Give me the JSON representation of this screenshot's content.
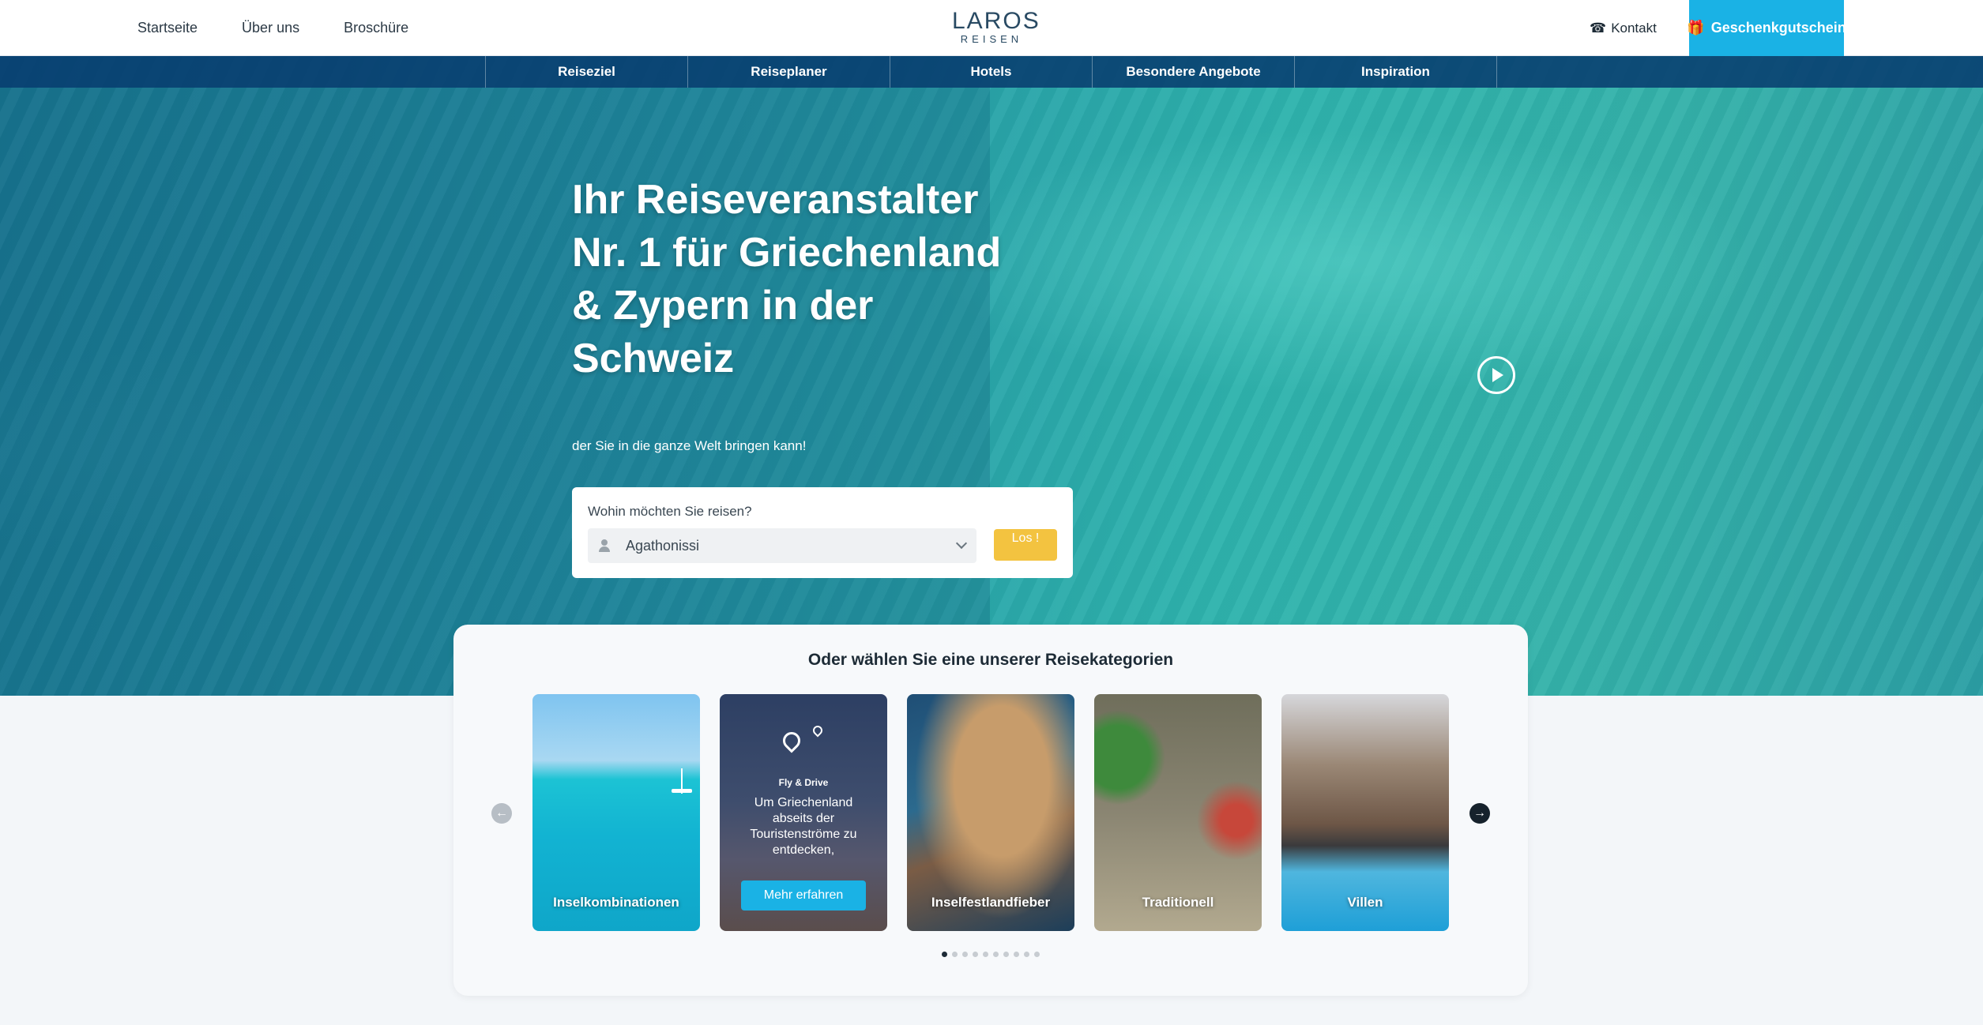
{
  "header": {
    "nav": [
      "Startseite",
      "Über uns",
      "Broschüre"
    ],
    "logo_main": "LAROS",
    "logo_sub": "REISEN",
    "contact_label": "Kontakt",
    "gift_label": "Geschenkgutschein"
  },
  "subnav": [
    "Reiseziel",
    "Reiseplaner",
    "Hotels",
    "Besondere Angebote",
    "Inspiration"
  ],
  "hero": {
    "headline": "Ihr Reiseveranstalter Nr. 1 für Griechenland & Zypern in der Schweiz",
    "subline": "der Sie in die ganze Welt bringen kann!"
  },
  "search": {
    "label": "Wohin möchten Sie reisen?",
    "selected": "Agathonissi",
    "button_label": "Los !"
  },
  "categories": {
    "title": "Oder wählen Sie eine unserer Reisekategorien",
    "tiles": [
      {
        "label": "Inselkombinationen"
      },
      {
        "title": "Fly & Drive",
        "text": "Um Griechenland abseits der Touristenströme zu entdecken,",
        "button": "Mehr erfahren"
      },
      {
        "label": "Inselfestlandfieber"
      },
      {
        "label": "Traditionell"
      },
      {
        "label": "Villen"
      }
    ],
    "dots_total": 10,
    "dots_active": 1
  },
  "colors": {
    "accent": "#1ab2e5",
    "button_yellow": "#f3c340",
    "subnav_bg": "#083e70"
  }
}
